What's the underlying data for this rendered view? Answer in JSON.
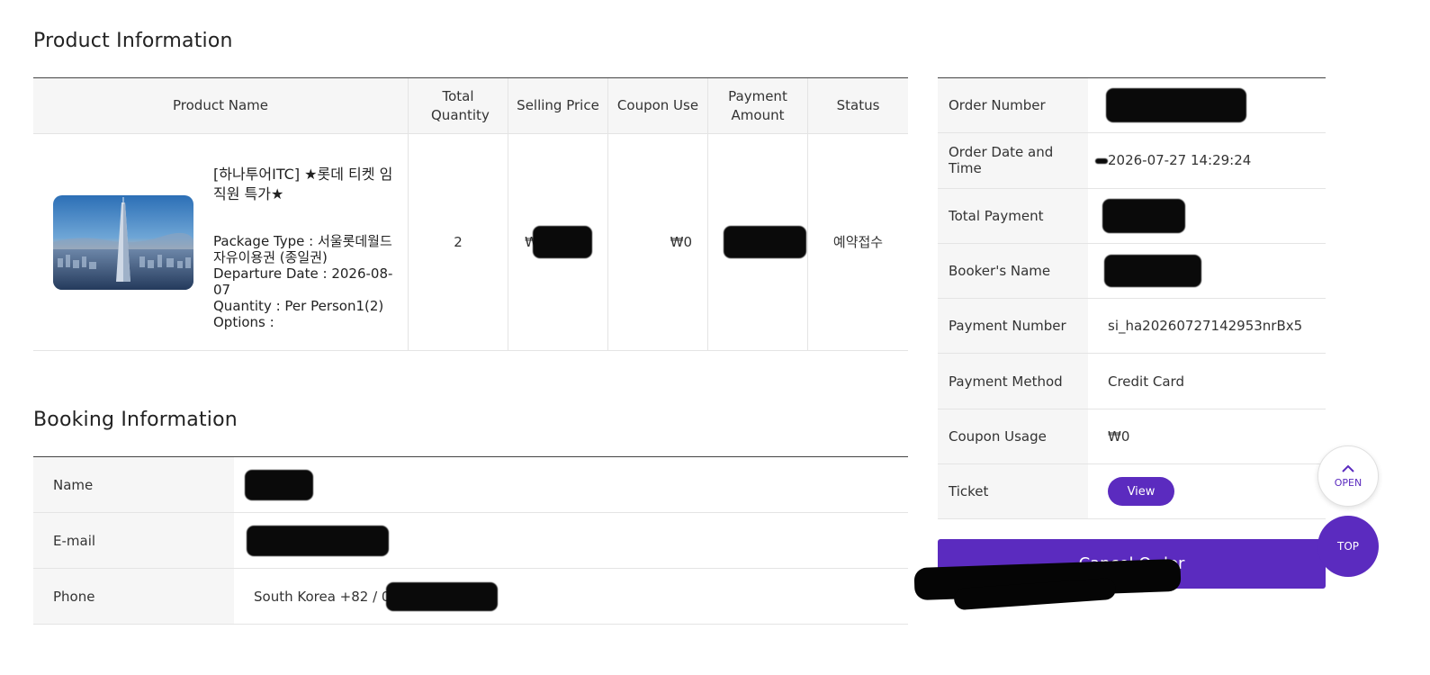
{
  "product_section": {
    "title": "Product Information",
    "headers": {
      "product_name": "Product Name",
      "total_quantity": "Total Quantity",
      "selling_price": "Selling Price",
      "coupon_use": "Coupon Use",
      "payment_amount": "Payment Amount",
      "status": "Status"
    },
    "row": {
      "name": "[하나투어ITC] ★롯데 티켓 임직원 특가★",
      "package_type": "Package Type : 서울롯데월드 자유이용권 (종일권)",
      "departure_date": "Departure Date : 2026-08-07",
      "quantity": "Quantity : Per Person1(2)",
      "options": "Options :",
      "total_quantity": "2",
      "selling_price_prefix": "₩",
      "coupon_use": "₩0",
      "status": "예약접수"
    }
  },
  "booking_section": {
    "title": "Booking Information",
    "rows": [
      {
        "label": "Name",
        "value": ""
      },
      {
        "label": "E-mail",
        "value": ""
      },
      {
        "label": "Phone",
        "value": "South Korea +82 / 0"
      }
    ]
  },
  "order_section": {
    "rows": [
      {
        "label": "Order Number",
        "value": ""
      },
      {
        "label": "Order Date and Time",
        "value": "2026-07-27 14:29:24"
      },
      {
        "label": "Total Payment",
        "value": ""
      },
      {
        "label": "Booker's Name",
        "value": ""
      },
      {
        "label": "Payment Number",
        "value": "si_ha20260727142953nrBx5"
      },
      {
        "label": "Payment Method",
        "value": "Credit Card"
      },
      {
        "label": "Coupon Usage",
        "value": "₩0"
      },
      {
        "label": "Ticket",
        "value": ""
      }
    ],
    "view_button": "View"
  },
  "actions": {
    "cancel_order": "Cancel Order",
    "open": "OPEN",
    "top": "TOP"
  },
  "colors": {
    "accent": "#5b2bbf",
    "header_bg": "#f6f6f6",
    "border": "#e4e4e4"
  }
}
